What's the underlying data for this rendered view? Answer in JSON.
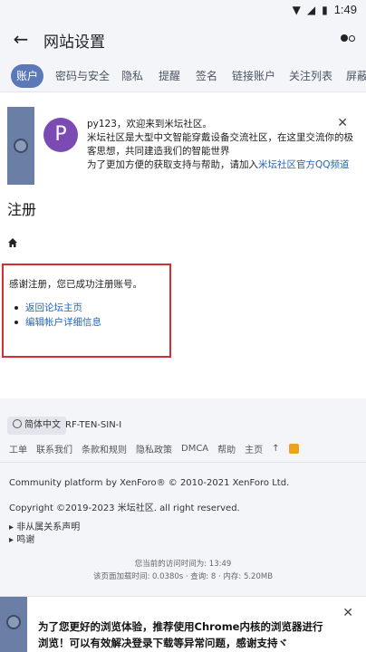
{
  "status": {
    "time": "1:49"
  },
  "appbar": {
    "title": "网站设置"
  },
  "tabs": [
    "账户",
    "密码与安全",
    "隐私",
    "提醒",
    "签名",
    "链接账户",
    "关注列表",
    "屏蔽"
  ],
  "notice": {
    "avatar_letter": "P",
    "line1": "py123，欢迎来到米坛社区。",
    "line2": "米坛社区是大型中文智能穿戴设备交流社区，在这里交流你的极客思想，共同建造我们的智能世界",
    "line3_prefix": "为了更加方便的获取支持与帮助，请加入",
    "line3_link": "米坛社区官方QQ频道"
  },
  "page": {
    "heading": "注册"
  },
  "panel": {
    "message": "感谢注册，您已成功注册账号。",
    "links": [
      "返回论坛主页",
      "编辑帐户详细信息"
    ]
  },
  "footer": {
    "language": "简体中文",
    "style": "RF-TEN-SIN-I",
    "links": [
      "工单",
      "联系我们",
      "条款和规则",
      "隐私政策",
      "DMCA",
      "帮助",
      "主页"
    ],
    "credit": "Community platform by XenForo® © 2010-2021 XenForo Ltd.",
    "copyright": "Copyright ©2019-2023 米坛社区. all right reserved.",
    "disclaimers": [
      "▸ 非从属关系声明",
      "▸ 鸣谢"
    ],
    "stats1": "您当前的访问时间为: 13:49",
    "stats2": "该页面加载时间: 0.0380s · 查询: 8 · 内存: 5.20MB"
  },
  "bottom_notice": {
    "text": "为了您更好的浏览体验，推荐使用Chrome内核的浏览器进行浏览！可以有效解决登录下载等异常问题，感谢支持ヾ"
  }
}
